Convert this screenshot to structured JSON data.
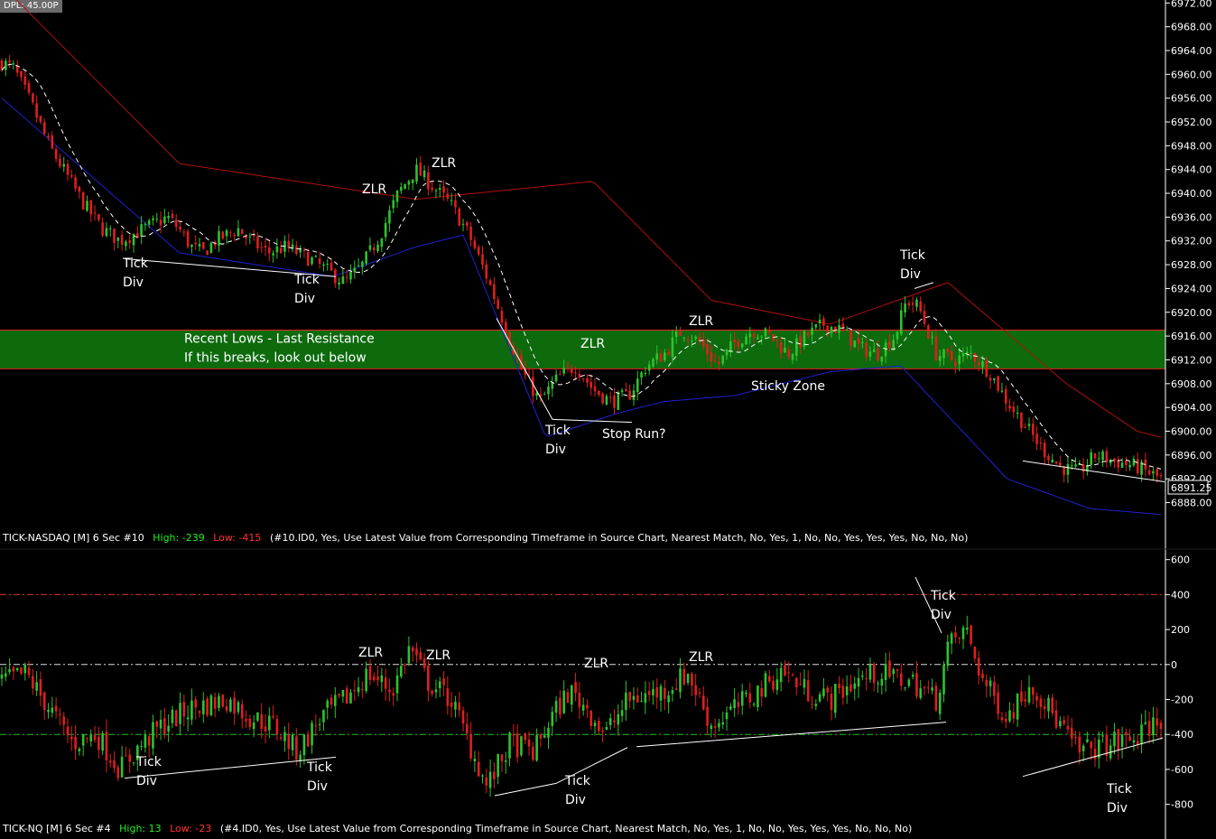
{
  "top_label": "DPL: 45.00P",
  "last_price": "6891.25",
  "colors": {
    "up": "#2ec32e",
    "down": "#e01e1e",
    "zone_fill": "#0d6a0d",
    "zone_border": "#e52222",
    "upper_band": "#b01010",
    "lower_band": "#2020d0",
    "mid_line": "#ffffff",
    "high_label": "#22ee22",
    "low_label": "#ff3030"
  },
  "chart_data": [
    {
      "type": "candlestick",
      "title": "",
      "y_ticks": [
        "6972.00",
        "6968.00",
        "6964.00",
        "6960.00",
        "6956.00",
        "6952.00",
        "6948.00",
        "6944.00",
        "6940.00",
        "6936.00",
        "6932.00",
        "6928.00",
        "6924.00",
        "6920.00",
        "6916.00",
        "6912.00",
        "6908.00",
        "6904.00",
        "6900.00",
        "6896.00",
        "6892.00",
        "6888.00"
      ],
      "ylim": [
        6885.5,
        6972.5
      ],
      "bar_count": 300,
      "close_anchors": [
        [
          0,
          6962
        ],
        [
          10,
          6961
        ],
        [
          25,
          6955
        ],
        [
          40,
          6948
        ],
        [
          55,
          6943
        ],
        [
          70,
          6938
        ],
        [
          85,
          6934
        ],
        [
          100,
          6932
        ],
        [
          120,
          6934
        ],
        [
          140,
          6936
        ],
        [
          150,
          6934
        ],
        [
          160,
          6931
        ],
        [
          170,
          6930
        ],
        [
          180,
          6932
        ],
        [
          190,
          6933
        ],
        [
          200,
          6934
        ],
        [
          210,
          6932
        ],
        [
          225,
          6930
        ],
        [
          240,
          6931
        ],
        [
          260,
          6929
        ],
        [
          275,
          6927
        ],
        [
          290,
          6925
        ],
        [
          305,
          6928
        ],
        [
          320,
          6933
        ],
        [
          335,
          6940
        ],
        [
          350,
          6944
        ],
        [
          365,
          6941
        ],
        [
          380,
          6938
        ],
        [
          395,
          6933
        ],
        [
          410,
          6926
        ],
        [
          425,
          6918
        ],
        [
          440,
          6910
        ],
        [
          455,
          6905
        ],
        [
          470,
          6909
        ],
        [
          485,
          6911
        ],
        [
          500,
          6907
        ],
        [
          515,
          6905
        ],
        [
          530,
          6906
        ],
        [
          545,
          6911
        ],
        [
          560,
          6913
        ],
        [
          575,
          6917
        ],
        [
          590,
          6915
        ],
        [
          605,
          6911
        ],
        [
          620,
          6915
        ],
        [
          635,
          6917
        ],
        [
          650,
          6916
        ],
        [
          665,
          6913
        ],
        [
          680,
          6916
        ],
        [
          695,
          6918
        ],
        [
          710,
          6917
        ],
        [
          725,
          6914
        ],
        [
          740,
          6913
        ],
        [
          755,
          6916
        ],
        [
          765,
          6922
        ],
        [
          775,
          6921
        ],
        [
          790,
          6913
        ],
        [
          805,
          6912
        ],
        [
          820,
          6913
        ],
        [
          835,
          6910
        ],
        [
          850,
          6905
        ],
        [
          865,
          6901
        ],
        [
          880,
          6897
        ],
        [
          895,
          6894
        ],
        [
          910,
          6893
        ],
        [
          925,
          6896
        ],
        [
          940,
          6895
        ],
        [
          960,
          6894
        ],
        [
          980,
          6892
        ]
      ],
      "upper_band": [
        [
          0,
          6975
        ],
        [
          150,
          6945
        ],
        [
          350,
          6939
        ],
        [
          500,
          6942
        ],
        [
          600,
          6922
        ],
        [
          700,
          6918
        ],
        [
          800,
          6925
        ],
        [
          900,
          6908
        ],
        [
          960,
          6900
        ],
        [
          980,
          6899
        ]
      ],
      "lower_band": [
        [
          0,
          6956
        ],
        [
          150,
          6930
        ],
        [
          280,
          6926
        ],
        [
          350,
          6931
        ],
        [
          390,
          6933
        ],
        [
          460,
          6899
        ],
        [
          520,
          6903
        ],
        [
          560,
          6905
        ],
        [
          620,
          6906
        ],
        [
          700,
          6910
        ],
        [
          760,
          6911
        ],
        [
          850,
          6892
        ],
        [
          920,
          6887
        ],
        [
          980,
          6886
        ]
      ],
      "price_zone": [
        6910.5,
        6917
      ],
      "zone_label": [
        "Recent Lows - Last Resistance",
        "If this breaks, look out below"
      ],
      "annotations": [
        "Tick Div",
        "Tick Div",
        "ZLR",
        "ZLR",
        "ZLR",
        "Tick Div",
        "Stop Run?",
        "ZLR",
        "Sticky Zone",
        "Tick Div"
      ],
      "legend": "TICK-NASDAQ [M]  6 Sec   #10  High: -239  Low: -415  (#10.ID0, Yes, Use Latest Value from Corresponding Timeframe in Source Chart, Nearest Match, No, Yes, 1, No, No, Yes, Yes, Yes, No, No, No)",
      "legend_parts": {
        "name": "TICK-NASDAQ [M]  6 Sec   #10",
        "high": "High: -239",
        "low": "Low: -415",
        "params": "(#10.ID0, Yes, Use Latest Value from Corresponding Timeframe in Source Chart, Nearest Match, No, Yes, 1, No, No, Yes, Yes, Yes, No, No, No)"
      }
    },
    {
      "type": "candlestick",
      "title": "",
      "y_ticks": [
        "600",
        "400",
        "200",
        "0",
        "-200",
        "-400",
        "-600",
        "-800"
      ],
      "ylim": [
        -900,
        650
      ],
      "reference_lines": [
        400,
        0,
        -400
      ],
      "bar_count": 300,
      "close_anchors": [
        [
          0,
          -100
        ],
        [
          20,
          -50
        ],
        [
          45,
          -300
        ],
        [
          60,
          -450
        ],
        [
          80,
          -400
        ],
        [
          100,
          -600
        ],
        [
          115,
          -480
        ],
        [
          135,
          -350
        ],
        [
          160,
          -250
        ],
        [
          190,
          -200
        ],
        [
          210,
          -300
        ],
        [
          230,
          -350
        ],
        [
          250,
          -500
        ],
        [
          270,
          -300
        ],
        [
          290,
          -200
        ],
        [
          310,
          -50
        ],
        [
          330,
          -150
        ],
        [
          345,
          100
        ],
        [
          360,
          -100
        ],
        [
          380,
          -200
        ],
        [
          395,
          -450
        ],
        [
          410,
          -700
        ],
        [
          430,
          -450
        ],
        [
          450,
          -500
        ],
        [
          465,
          -300
        ],
        [
          480,
          -150
        ],
        [
          495,
          -250
        ],
        [
          510,
          -400
        ],
        [
          530,
          -200
        ],
        [
          560,
          -150
        ],
        [
          580,
          -50
        ],
        [
          600,
          -350
        ],
        [
          620,
          -250
        ],
        [
          640,
          -150
        ],
        [
          660,
          -30
        ],
        [
          680,
          -150
        ],
        [
          700,
          -200
        ],
        [
          720,
          -100
        ],
        [
          740,
          -50
        ],
        [
          770,
          -100
        ],
        [
          790,
          -200
        ],
        [
          800,
          100
        ],
        [
          815,
          200
        ],
        [
          830,
          -100
        ],
        [
          850,
          -300
        ],
        [
          870,
          -100
        ],
        [
          890,
          -300
        ],
        [
          910,
          -500
        ],
        [
          940,
          -450
        ],
        [
          960,
          -420
        ],
        [
          980,
          -300
        ]
      ],
      "annotations": [
        "ZLR",
        "ZLR",
        "ZLR",
        "ZLR",
        "Tick Div",
        "Tick Div",
        "Tick Div",
        "Tick Div",
        "Tick Div"
      ],
      "legend": "TICK-NQ [M]  6 Sec   #4  High: 13  Low: -23  (#4.ID0, Yes, Use Latest Value from Corresponding Timeframe in Source Chart, Nearest Match, No, Yes, 1, No, No, Yes, Yes, Yes, No, No, No)",
      "legend_parts": {
        "name": "TICK-NQ [M]  6 Sec   #4",
        "high": "High: 13",
        "low": "Low: -23",
        "params": "(#4.ID0, Yes, Use Latest Value from Corresponding Timeframe in Source Chart, Nearest Match, No, Yes, 1, No, No, Yes, Yes, Yes, No, No, No)"
      }
    }
  ]
}
